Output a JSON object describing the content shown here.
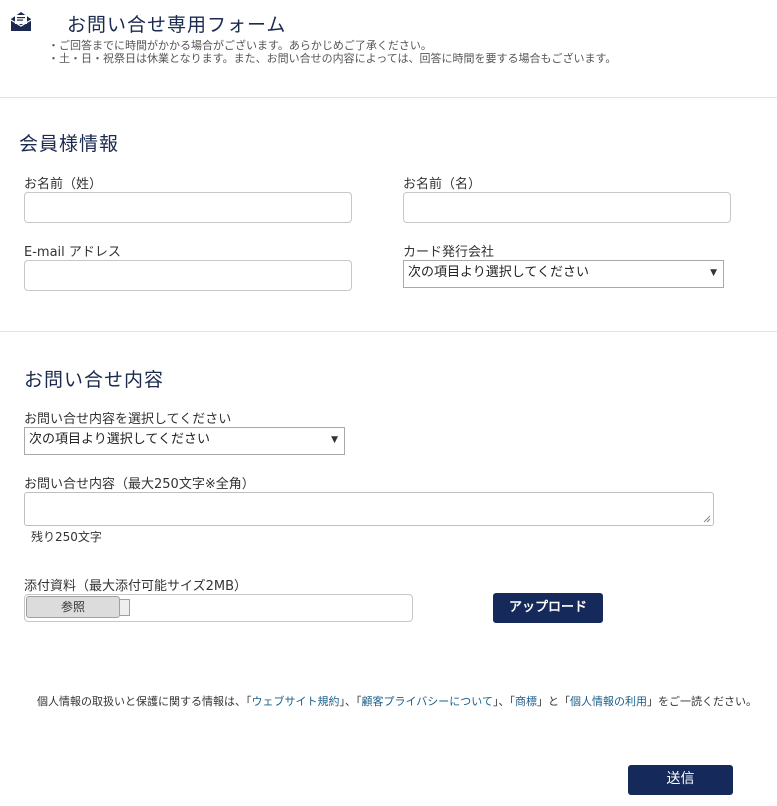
{
  "header": {
    "title": "お問い合せ専用フォーム",
    "notes": [
      "・ご回答までに時間がかかる場合がございます。あらかじめご了承ください。",
      "・土・日・祝祭日は休業となります。また、お問い合せの内容によっては、回答に時間を要する場合もございます。"
    ]
  },
  "member": {
    "title": "会員様情報",
    "last_name_label": "お名前（姓）",
    "first_name_label": "お名前（名）",
    "email_label": "E-mail アドレス",
    "card_company_label": "カード発行会社",
    "card_company_selected": "次の項目より選択してください"
  },
  "inquiry": {
    "title": "お問い合せ内容",
    "type_label": "お問い合せ内容を選択してください",
    "type_selected": "次の項目より選択してください",
    "content_label": "お問い合せ内容（最大250文字※全角）",
    "remaining": "残り250文字",
    "attachment_label": "添付資料（最大添付可能サイズ2MB）",
    "browse_label": "参照",
    "upload_label": "アップロード"
  },
  "privacy": {
    "prefix": "個人情報の取扱いと保護に関する情報は、「",
    "link1": "ウェブサイト規約",
    "sep1": "」、「",
    "link2": "顧客プライバシーについて",
    "sep2": "」、「",
    "link3": "商標",
    "sep3": "」と「",
    "link4": "個人情報の利用",
    "suffix": "」をご一読ください。"
  },
  "submit_label": "送信",
  "colors": {
    "brand_navy": "#15295a",
    "link": "#1a5f8a"
  },
  "icons": {
    "header": "envelope-icon",
    "select_arrow": "chevron-down-icon"
  }
}
